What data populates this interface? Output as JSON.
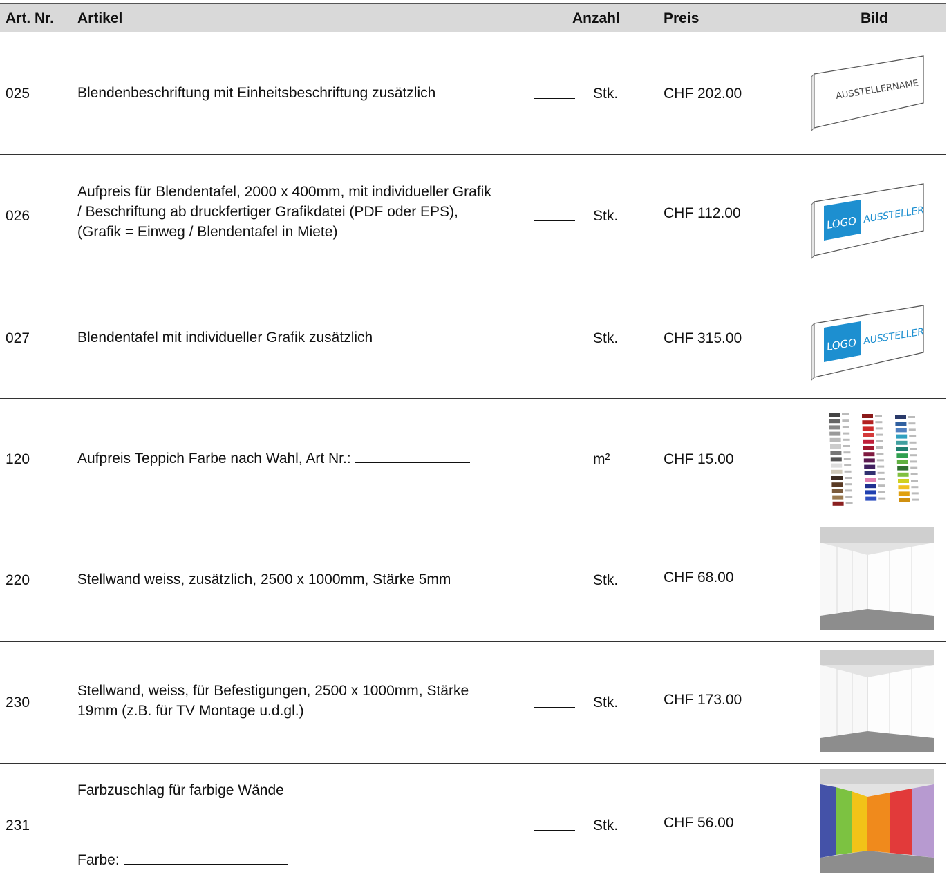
{
  "header": {
    "art_nr": "Art. Nr.",
    "artikel": "Artikel",
    "anzahl": "Anzahl",
    "preis": "Preis",
    "bild": "Bild"
  },
  "rows": [
    {
      "nr": "025",
      "desc": [
        "Blendenbeschriftung mit Einheitsbeschriftung zusätzlich"
      ],
      "unit": "Stk.",
      "price": "CHF 202.00",
      "image": "sign-panel-text",
      "image_text": "AUSSTELLERNAME"
    },
    {
      "nr": "026",
      "desc": [
        "Aufpreis für Blendentafel, 2000 x 400mm, mit individueller Grafik",
        "/ Beschriftung ab druckfertiger Grafikdatei (PDF oder EPS),",
        "(Grafik = Einweg / Blendentafel in Miete)"
      ],
      "unit": "Stk.",
      "price": "CHF 112.00",
      "image": "sign-panel-logo",
      "image_logo": "LOGO",
      "image_text": "AUSSTELLER"
    },
    {
      "nr": "027",
      "desc": [
        "Blendentafel mit individueller Grafik zusätzlich"
      ],
      "unit": "Stk.",
      "price": "CHF 315.00",
      "image": "sign-panel-logo",
      "image_logo": "LOGO",
      "image_text": "AUSSTELLER"
    },
    {
      "nr": "120",
      "desc_prefix": "Aufpreis Teppich Farbe nach Wahl, Art Nr.:",
      "unit": "m²",
      "price": "CHF 15.00",
      "image": "carpet-color-swatches"
    },
    {
      "nr": "220",
      "desc": [
        "Stellwand weiss, zusätzlich, 2500 x 1000mm, Stärke 5mm"
      ],
      "unit": "Stk.",
      "price": "CHF 68.00",
      "image": "white-wall-room"
    },
    {
      "nr": "230",
      "desc": [
        "Stellwand, weiss, für Befestigungen, 2500 x 1000mm, Stärke",
        "19mm (z.B. für TV Montage u.d.gl.)"
      ],
      "unit": "Stk.",
      "price": "CHF 173.00",
      "image": "white-wall-room"
    },
    {
      "nr": "231",
      "desc_top": "Farbzuschlag für farbige Wände",
      "desc_bottom_label": "Farbe:",
      "unit": "Stk.",
      "price": "CHF 56.00",
      "image": "colored-wall-room"
    }
  ],
  "colors": {
    "header_bg": "#d9d9d9",
    "logo_blue": "#1d8fd0",
    "wall_colors": [
      "#4452a8",
      "#7cc241",
      "#f2c318",
      "#f08a1c",
      "#e23a3a",
      "#b79ad0"
    ]
  }
}
